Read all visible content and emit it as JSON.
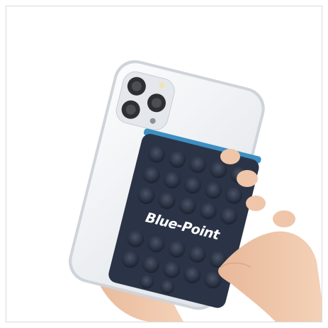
{
  "image": {
    "subject": "phone-with-suction-mount",
    "product_logo_text": "Blue-Point",
    "colors": {
      "background": "#ffffff",
      "phone_body": "#f1f3f5",
      "mount_pad": "#2b3446",
      "mount_accent": "#3d8fc2",
      "skin": "#f0c9ad"
    }
  }
}
